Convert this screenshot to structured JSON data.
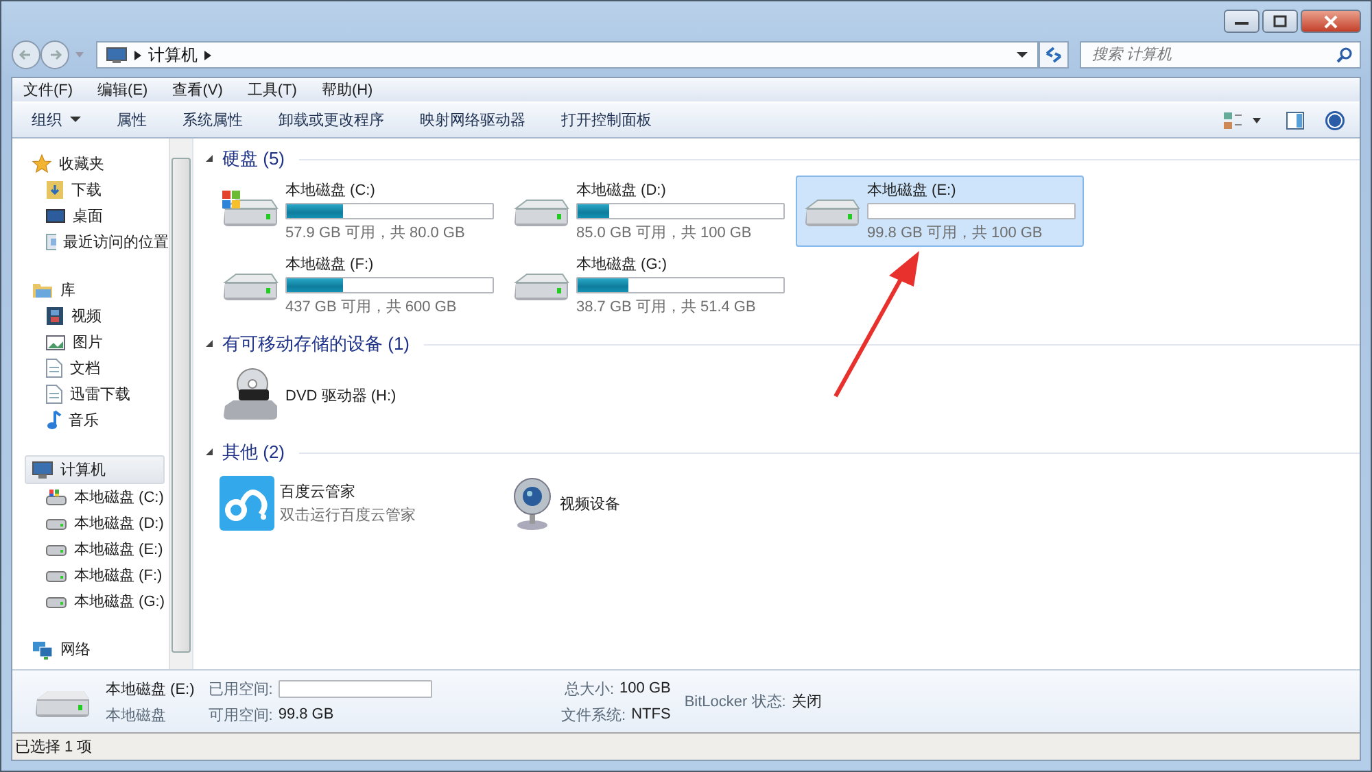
{
  "address": {
    "path": "计算机"
  },
  "search": {
    "placeholder": "搜索 计算机"
  },
  "menu": [
    "文件(F)",
    "编辑(E)",
    "查看(V)",
    "工具(T)",
    "帮助(H)"
  ],
  "toolbar": [
    {
      "label": "组织",
      "dropdown": true
    },
    {
      "label": "属性",
      "dropdown": false
    },
    {
      "label": "系统属性",
      "dropdown": false
    },
    {
      "label": "卸载或更改程序",
      "dropdown": false
    },
    {
      "label": "映射网络驱动器",
      "dropdown": false
    },
    {
      "label": "打开控制面板",
      "dropdown": false
    }
  ],
  "sidebar": {
    "items": [
      {
        "label": "收藏夹",
        "selected": false,
        "children": [
          {
            "label": "下载"
          },
          {
            "label": "桌面"
          },
          {
            "label": "最近访问的位置"
          }
        ]
      },
      {
        "label": "库",
        "selected": false,
        "children": [
          {
            "label": "视频"
          },
          {
            "label": "图片"
          },
          {
            "label": "文档"
          },
          {
            "label": "迅雷下载"
          },
          {
            "label": "音乐"
          }
        ]
      },
      {
        "label": "计算机",
        "selected": true,
        "children": [
          {
            "label": "本地磁盘 (C:)"
          },
          {
            "label": "本地磁盘 (D:)"
          },
          {
            "label": "本地磁盘 (E:)"
          },
          {
            "label": "本地磁盘 (F:)"
          },
          {
            "label": "本地磁盘 (G:)"
          }
        ]
      },
      {
        "label": "网络",
        "selected": false
      }
    ]
  },
  "groups": [
    {
      "title": "硬盘 (5)",
      "items": [
        {
          "kind": "drive",
          "system": true,
          "name": "本地磁盘 (C:)",
          "level": 0.276,
          "info": "57.9 GB 可用，共 80.0 GB",
          "selected": false
        },
        {
          "kind": "drive",
          "system": false,
          "name": "本地磁盘 (D:)",
          "level": 0.15,
          "info": "85.0 GB 可用，共 100 GB",
          "selected": false
        },
        {
          "kind": "drive",
          "system": false,
          "name": "本地磁盘 (E:)",
          "level": 0.002,
          "info": "99.8 GB 可用，共 100 GB",
          "selected": true
        },
        {
          "kind": "drive",
          "system": false,
          "name": "本地磁盘 (F:)",
          "level": 0.272,
          "info": "437 GB 可用，共 600 GB",
          "selected": false
        },
        {
          "kind": "drive",
          "system": false,
          "name": "本地磁盘 (G:)",
          "level": 0.247,
          "info": "38.7 GB 可用，共 51.4 GB",
          "selected": false
        }
      ]
    },
    {
      "title": "有可移动存储的设备 (1)",
      "items": [
        {
          "kind": "dvd",
          "name": "DVD 驱动器 (H:)",
          "selected": false
        }
      ]
    },
    {
      "title": "其他 (2)",
      "items": [
        {
          "kind": "app",
          "name": "百度云管家",
          "info": "双击运行百度云管家",
          "selected": false
        },
        {
          "kind": "camera",
          "name": "视频设备",
          "selected": false
        }
      ]
    }
  ],
  "details": {
    "name": "本地磁盘 (E:)",
    "type": "本地磁盘",
    "used_label": "已用空间:",
    "level": 0.002,
    "free_label": "可用空间:",
    "free": "99.8 GB",
    "total_label": "总大小:",
    "total": "100 GB",
    "fs_label": "文件系统:",
    "fs": "NTFS",
    "bitlocker_label": "BitLocker 状态:",
    "bitlocker": "关闭"
  },
  "status_bar": "已选择 1 项"
}
